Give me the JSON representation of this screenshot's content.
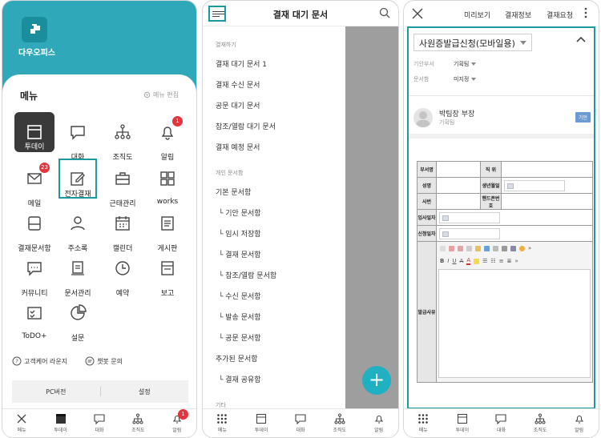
{
  "panel1": {
    "app_name": "다우오피스",
    "menu_title": "메뉴",
    "menu_edit": "메뉴 편집",
    "grid": [
      {
        "label": "투데이",
        "icon": "today-icon",
        "badge": ""
      },
      {
        "label": "대화",
        "icon": "chat-icon",
        "badge": ""
      },
      {
        "label": "조직도",
        "icon": "org-chart-icon",
        "badge": ""
      },
      {
        "label": "알림",
        "icon": "bell-icon",
        "badge": "1"
      },
      {
        "label": "메일",
        "icon": "mail-icon",
        "badge": "23"
      },
      {
        "label": "전자결재",
        "icon": "approval-edit-icon",
        "badge": ""
      },
      {
        "label": "근태관리",
        "icon": "briefcase-icon",
        "badge": ""
      },
      {
        "label": "works",
        "icon": "works-grid-icon",
        "badge": ""
      },
      {
        "label": "결재문서함",
        "icon": "inbox-icon",
        "badge": ""
      },
      {
        "label": "주소록",
        "icon": "person-icon",
        "badge": ""
      },
      {
        "label": "캘린더",
        "icon": "calendar-icon",
        "badge": ""
      },
      {
        "label": "게시판",
        "icon": "board-icon",
        "badge": ""
      },
      {
        "label": "커뮤니티",
        "icon": "community-icon",
        "badge": ""
      },
      {
        "label": "문서관리",
        "icon": "document-icon",
        "badge": ""
      },
      {
        "label": "예약",
        "icon": "clock-icon",
        "badge": ""
      },
      {
        "label": "보고",
        "icon": "report-icon",
        "badge": ""
      },
      {
        "label": "ToDO+",
        "icon": "todo-icon",
        "badge": ""
      },
      {
        "label": "설문",
        "icon": "survey-icon",
        "badge": ""
      }
    ],
    "link_care": "고객케어 라운지",
    "link_chatbot": "챗봇 문의",
    "btn_pc": "PC버전",
    "btn_settings": "설정",
    "tabs": [
      {
        "label": "메뉴",
        "badge": ""
      },
      {
        "label": "투데이",
        "badge": ""
      },
      {
        "label": "대화",
        "badge": ""
      },
      {
        "label": "조직도",
        "badge": ""
      },
      {
        "label": "알림",
        "badge": "1"
      }
    ]
  },
  "panel2": {
    "title": "결재 대기 문서",
    "section_approval": "결재하기",
    "items_approval": [
      "결재 대기 문서 1",
      "결재 수신 문서",
      "공문 대기 문서",
      "참조/열람 대기 문서",
      "결재 예정 문서"
    ],
    "section_personal": "개인 문서함",
    "item_personal_head": "기본 문서함",
    "items_personal": [
      "└ 기안 문서함",
      "└ 임시 저장함",
      "└ 결재 문서함",
      "└ 참조/열람 문서함",
      "└ 수신 문서함",
      "└ 발송 문서함",
      "└ 공문 문서함"
    ],
    "item_added": "추가된 문서함",
    "item_shared": "└ 결재 공유함",
    "section_other": "기타",
    "fab": "+",
    "tabs": [
      "메뉴",
      "투데이",
      "대화",
      "조직도",
      "알림"
    ]
  },
  "panel3": {
    "actions": [
      "미리보기",
      "결재정보",
      "결재요청"
    ],
    "form_name": "사원증발급신청(모바일용)",
    "dept_label": "기안부서",
    "dept_value": "기획팀",
    "secure_label": "문서함",
    "secure_value": "미지정",
    "approver_name": "박팀장 부장",
    "approver_dept": "기획팀",
    "approver_badge": "기안",
    "table": {
      "dept": "부서명",
      "position": "직 위",
      "name": "성명",
      "birth": "생년월일",
      "emp_no": "사번",
      "phone": "핸드폰번호",
      "join_date": "입사일자",
      "apply_date": "신청일자",
      "reason": "발급사유"
    },
    "tabs": [
      "메뉴",
      "투데이",
      "대화",
      "조직도",
      "알림"
    ]
  }
}
